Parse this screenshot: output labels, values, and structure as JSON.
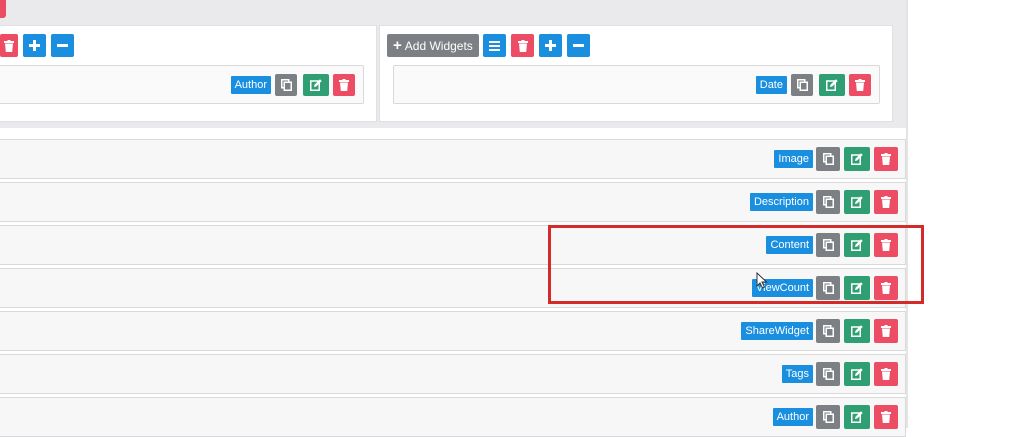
{
  "colors": {
    "primary": "#1a8fe0",
    "danger": "#ec4d64",
    "secondary": "#7c7f83",
    "success": "#2f9e72",
    "highlight": "#d42a2a"
  },
  "icons": {
    "add": "plus-icon",
    "remove": "minus-icon",
    "delete": "trash-icon",
    "copy": "copy-icon",
    "edit": "edit-icon",
    "menu": "list-icon"
  },
  "columns": {
    "left": {
      "widget_label": "Author"
    },
    "right": {
      "add_widgets_label": "Add Widgets",
      "widget_label": "Date"
    }
  },
  "rows": [
    {
      "label": "Image"
    },
    {
      "label": "Description"
    },
    {
      "label": "Content"
    },
    {
      "label": "ViewCount"
    },
    {
      "label": "ShareWidget"
    },
    {
      "label": "Tags"
    },
    {
      "label": "Author"
    }
  ]
}
